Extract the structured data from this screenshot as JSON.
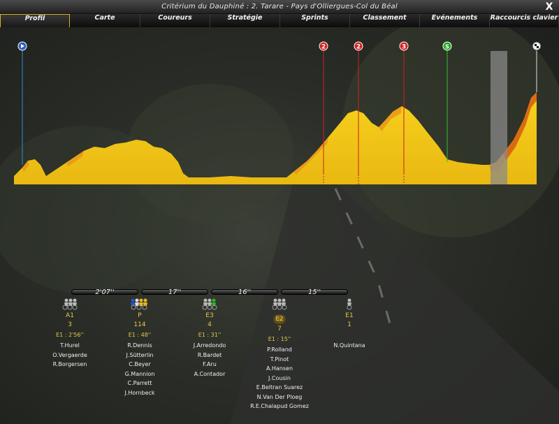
{
  "window": {
    "title": "Critérium du Dauphiné : 2. Tarare - Pays d'Olliergues-Col du Béal",
    "close_label": "X"
  },
  "tabs": [
    {
      "label": "Profil",
      "active": true
    },
    {
      "label": "Carte"
    },
    {
      "label": "Coureurs"
    },
    {
      "label": "Stratégie"
    },
    {
      "label": "Sprints"
    },
    {
      "label": "Classement"
    },
    {
      "label": "Evénements"
    },
    {
      "label": "Raccourcis clavier"
    }
  ],
  "profile": {
    "markers": [
      {
        "type": "start",
        "label": ""
      },
      {
        "type": "climb",
        "label": "2",
        "color": "#d22020"
      },
      {
        "type": "climb",
        "label": "2",
        "color": "#d22020"
      },
      {
        "type": "climb",
        "label": "3",
        "color": "#d22020"
      },
      {
        "type": "sprint",
        "label": "S",
        "color": "#22aa22"
      },
      {
        "type": "finish",
        "label": ""
      }
    ],
    "fill_color": "#f2c81a"
  },
  "gaps": [
    "2'07''",
    "17''",
    "16''",
    "15''"
  ],
  "groups": [
    {
      "name": "A1",
      "count": "3",
      "gap": "E1 : 2'56''",
      "riders": [
        "T.Hurel",
        "O.Vergaerde",
        "R.Borgersen"
      ],
      "highlight": false
    },
    {
      "name": "P",
      "count": "114",
      "gap": "E1 : 48''",
      "riders": [
        "R.Dennis",
        "J.Sütterlin",
        "C.Beyer",
        "G.Mannion",
        "C.Parrett",
        "J.Hornbeck"
      ],
      "highlight": false
    },
    {
      "name": "E3",
      "count": "4",
      "gap": "E1 : 31''",
      "riders": [
        "J.Arredondo",
        "R.Bardet",
        "F.Aru",
        "A.Contador"
      ],
      "highlight": false
    },
    {
      "name": "E2",
      "count": "7",
      "gap": "E1 : 15''",
      "riders": [
        "P.Rolland",
        "T.Pinot",
        "A.Hansen",
        "J.Cousin",
        "E.Beltran Suarez",
        "N.Van Der Ploeg",
        "R.E.Chalapud Gomez"
      ],
      "highlight": true
    },
    {
      "name": "E1",
      "count": "1",
      "gap": "",
      "riders": [
        "N.Quintana"
      ],
      "highlight": false
    }
  ],
  "colors": {
    "accent": "#e8c84a",
    "tab_border": "#d6b21d"
  }
}
